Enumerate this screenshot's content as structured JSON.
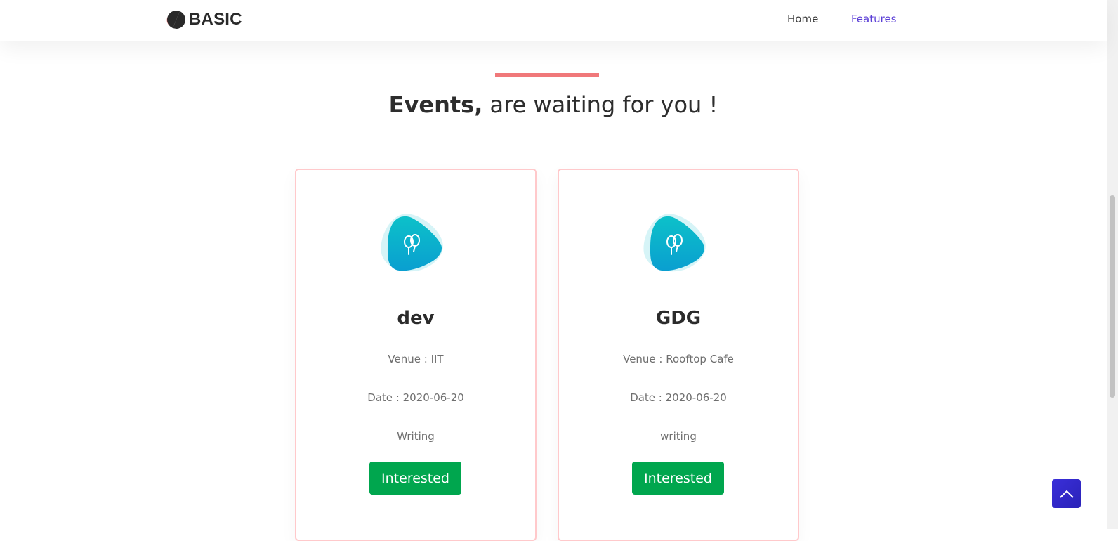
{
  "brand": {
    "name": "BASIC",
    "logo_icon": "half-circle-logo-icon",
    "accent_color": "#f27a7c"
  },
  "nav": {
    "home": "Home",
    "features": "Features",
    "active": "features",
    "active_color": "#5b3fd6"
  },
  "section": {
    "title_bold": "Events,",
    "title_rest": " are waiting for you !",
    "divider_color": "#f0787a"
  },
  "events": [
    {
      "icon": "balloons-icon",
      "name": "dev",
      "venue": "Venue : IIT",
      "date": "Date : 2020-06-20",
      "description": "Writing",
      "button": "Interested"
    },
    {
      "icon": "balloons-icon",
      "name": "GDG",
      "venue": "Venue : Rooftop Cafe",
      "date": "Date : 2020-06-20",
      "description": "writing",
      "button": "Interested"
    }
  ],
  "colors": {
    "button_green": "#00a64e",
    "card_border": "#ffc9cb",
    "icon_teal": "#0bb0c9",
    "scroll_top_blue": "#3a2fd9"
  },
  "scroll_top": {
    "icon": "chevron-up-icon"
  }
}
